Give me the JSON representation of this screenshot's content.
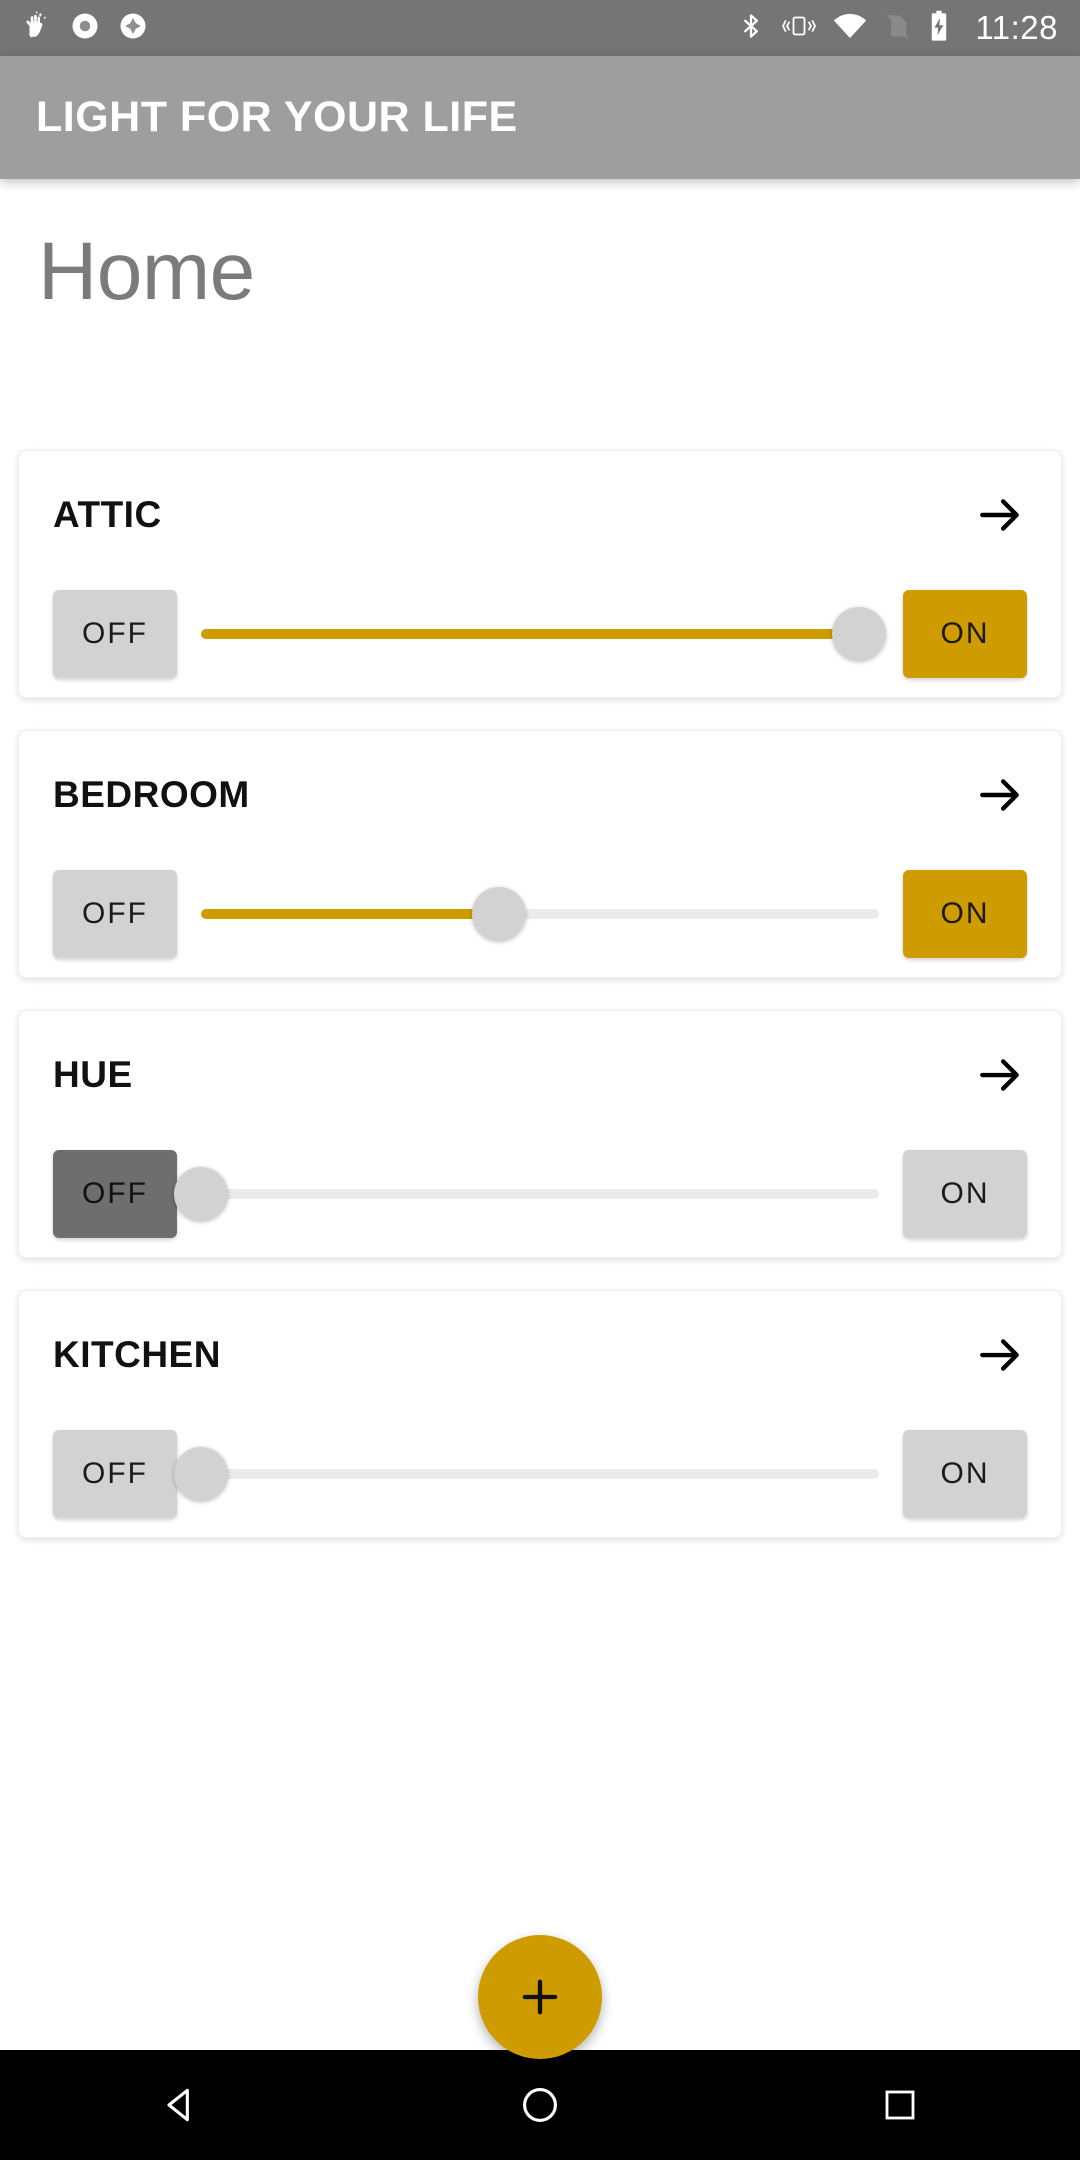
{
  "status_bar": {
    "notification_icons": [
      "clean-sparkle-icon",
      "record-circle-icon",
      "diamond-icon"
    ],
    "system_icons": [
      "bluetooth-icon",
      "vibrate-icon",
      "wifi-icon",
      "no-sim-icon",
      "battery-charging-icon"
    ],
    "clock": "11:28"
  },
  "app_bar": {
    "title": "LIGHT FOR YOUR LIFE"
  },
  "page": {
    "title": "Home"
  },
  "colors": {
    "accent_gold": "#cf9c00",
    "app_bar_gray": "#9e9e9e",
    "status_gray": "#757575",
    "inactive_gray": "#d2d2d2",
    "active_dark_gray": "#6e6e6e",
    "track_gray": "#ebebeb"
  },
  "labels": {
    "off": "OFF",
    "on": "ON",
    "add": "+"
  },
  "rooms": [
    {
      "name": "ATTIC",
      "brightness": 97,
      "off_state": "inactive",
      "on_state": "active-gold"
    },
    {
      "name": "BEDROOM",
      "brightness": 44,
      "off_state": "inactive",
      "on_state": "active-gold"
    },
    {
      "name": "HUE",
      "brightness": 0,
      "off_state": "active-dark",
      "on_state": "inactive"
    },
    {
      "name": "KITCHEN",
      "brightness": 0,
      "off_state": "inactive",
      "on_state": "inactive"
    }
  ],
  "nav_bar": {
    "buttons": [
      "back-triangle-icon",
      "home-circle-icon",
      "recents-square-icon"
    ]
  }
}
